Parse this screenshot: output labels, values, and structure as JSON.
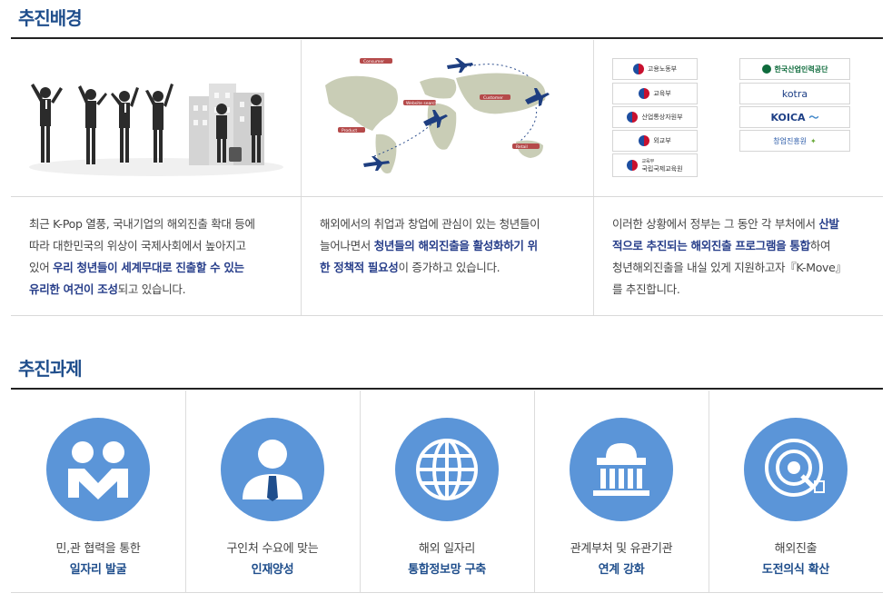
{
  "background": {
    "title": "추진배경",
    "world_map_labels": [
      "Consumer",
      "Website search",
      "Product",
      "Customer",
      "Retail"
    ],
    "logos_left": [
      "고용노동부",
      "교육부",
      "산업통상자원부",
      "외교부",
      "국립국제교육원"
    ],
    "logos_left_small": "교육부",
    "logos_right": [
      "한국산업인력공단",
      "kotra",
      "KOICA",
      "창업진흥원"
    ],
    "col1": {
      "t1": "최근 K-Pop 열풍, 국내기업의 해외진출 확대 등에",
      "t2": "따라 대한민국의 위상이 국제사회에서 높아지고",
      "t3a": "있어 ",
      "t3b": "우리 청년들이 세계무대로 진출할 수 있는",
      "t4b": "유리한 여건이 조성",
      "t4c": "되고 있습니다."
    },
    "col2": {
      "t1": "해외에서의 취업과 창업에 관심이 있는 청년들이",
      "t2a": "늘어나면서 ",
      "t2b": "청년들의 해외진출을 활성화하기 위",
      "t3b": "한 정책적 필요성",
      "t3c": "이 증가하고 있습니다."
    },
    "col3": {
      "t1a": "이러한 상황에서 정부는 그 동안 각 부처에서 ",
      "t1b": "산발",
      "t2b": "적으로 추진되는 해외진출 프로그램을 통합",
      "t2c": "하여",
      "t3": "청년해외진출을 내실 있게 지원하고자『K-Move』",
      "t4": "를 추진합니다."
    }
  },
  "tasks": {
    "title": "추진과제",
    "items": [
      {
        "line1": "민,관 협력을 통한",
        "line2": "일자리 발굴",
        "icon": "partnership-icon"
      },
      {
        "line1": "구인처 수요에 맞는",
        "line2": "인재양성",
        "icon": "person-icon"
      },
      {
        "line1": "해외 일자리",
        "line2": "통합정보망 구축",
        "icon": "globe-icon"
      },
      {
        "line1": "관계부처 및 유관기관",
        "line2": "연계 강화",
        "icon": "government-building-icon"
      },
      {
        "line1": "해외진출",
        "line2": "도전의식 확산",
        "icon": "target-icon"
      }
    ]
  },
  "colors": {
    "title": "#1f4e8c",
    "accent_text": "#273e8a",
    "icon_circle": "#5b95d8"
  }
}
